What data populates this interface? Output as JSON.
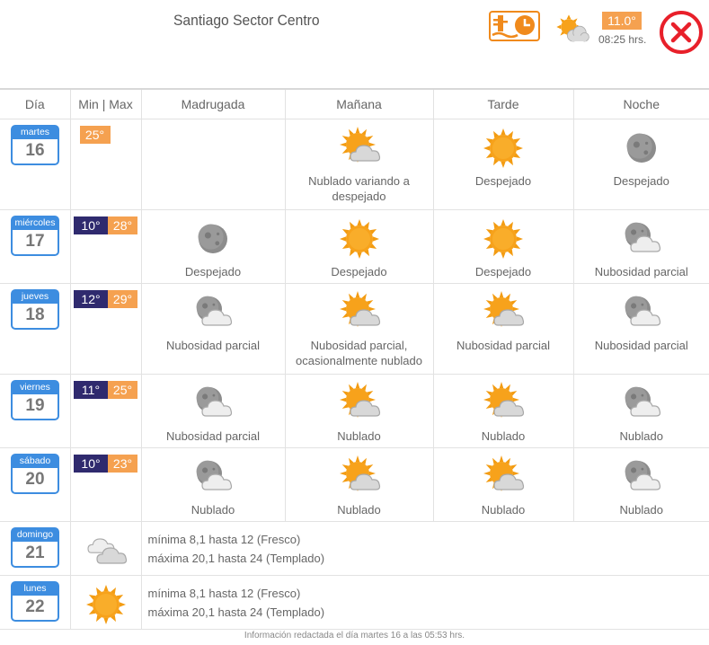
{
  "header": {
    "location": "Santiago Sector Centro",
    "current_temp": "11.0°",
    "current_time": "08:25 hrs.",
    "station_icon": "station-clock-icon",
    "current_icon": "sun-cloud-icon",
    "close_icon": "close-icon"
  },
  "colors": {
    "orange": "#f5a150",
    "navy": "#2f2a6e",
    "blue": "#3d8de0",
    "red": "#e8202a"
  },
  "columns": [
    "Día",
    "Min | Max",
    "Madrugada",
    "Mañana",
    "Tarde",
    "Noche"
  ],
  "days": [
    {
      "name": "martes",
      "num": "16",
      "min": "",
      "max": "25°",
      "periods": [
        {
          "icon": "",
          "label": ""
        },
        {
          "icon": "sun-cloud-icon",
          "label": "Nublado variando a despejado"
        },
        {
          "icon": "sun-icon",
          "label": "Despejado"
        },
        {
          "icon": "moon-icon",
          "label": "Despejado"
        }
      ]
    },
    {
      "name": "miércoles",
      "num": "17",
      "min": "10°",
      "max": "28°",
      "periods": [
        {
          "icon": "moon-icon",
          "label": "Despejado"
        },
        {
          "icon": "sun-icon",
          "label": "Despejado"
        },
        {
          "icon": "sun-icon",
          "label": "Despejado"
        },
        {
          "icon": "moon-cloud-icon",
          "label": "Nubosidad parcial"
        }
      ]
    },
    {
      "name": "jueves",
      "num": "18",
      "min": "12°",
      "max": "29°",
      "periods": [
        {
          "icon": "moon-cloud-icon",
          "label": "Nubosidad parcial"
        },
        {
          "icon": "sun-cloud-icon",
          "label": "Nubosidad parcial, ocasionalmente nublado"
        },
        {
          "icon": "sun-cloud-icon",
          "label": "Nubosidad parcial"
        },
        {
          "icon": "moon-cloud-icon",
          "label": "Nubosidad parcial"
        }
      ]
    },
    {
      "name": "viernes",
      "num": "19",
      "min": "11°",
      "max": "25°",
      "periods": [
        {
          "icon": "moon-cloud-icon",
          "label": "Nubosidad parcial"
        },
        {
          "icon": "sun-cloud-icon",
          "label": "Nublado"
        },
        {
          "icon": "sun-cloud-icon",
          "label": "Nublado"
        },
        {
          "icon": "moon-cloud-icon",
          "label": "Nublado"
        }
      ]
    },
    {
      "name": "sábado",
      "num": "20",
      "min": "10°",
      "max": "23°",
      "periods": [
        {
          "icon": "moon-cloud-icon",
          "label": "Nublado"
        },
        {
          "icon": "sun-cloud-icon",
          "label": "Nublado"
        },
        {
          "icon": "sun-cloud-icon",
          "label": "Nublado"
        },
        {
          "icon": "moon-cloud-icon",
          "label": "Nublado"
        }
      ]
    }
  ],
  "extended": [
    {
      "name": "domingo",
      "num": "21",
      "icon": "clouds-icon",
      "min_line": "mínima 8,1 hasta 12 (Fresco)",
      "max_line": "máxima 20,1 hasta 24 (Templado)"
    },
    {
      "name": "lunes",
      "num": "22",
      "icon": "sun-icon",
      "min_line": "mínima 8,1 hasta 12 (Fresco)",
      "max_line": "máxima 20,1 hasta 24 (Templado)"
    }
  ],
  "footer": "Información redactada el día martes 16 a las 05:53 hrs."
}
